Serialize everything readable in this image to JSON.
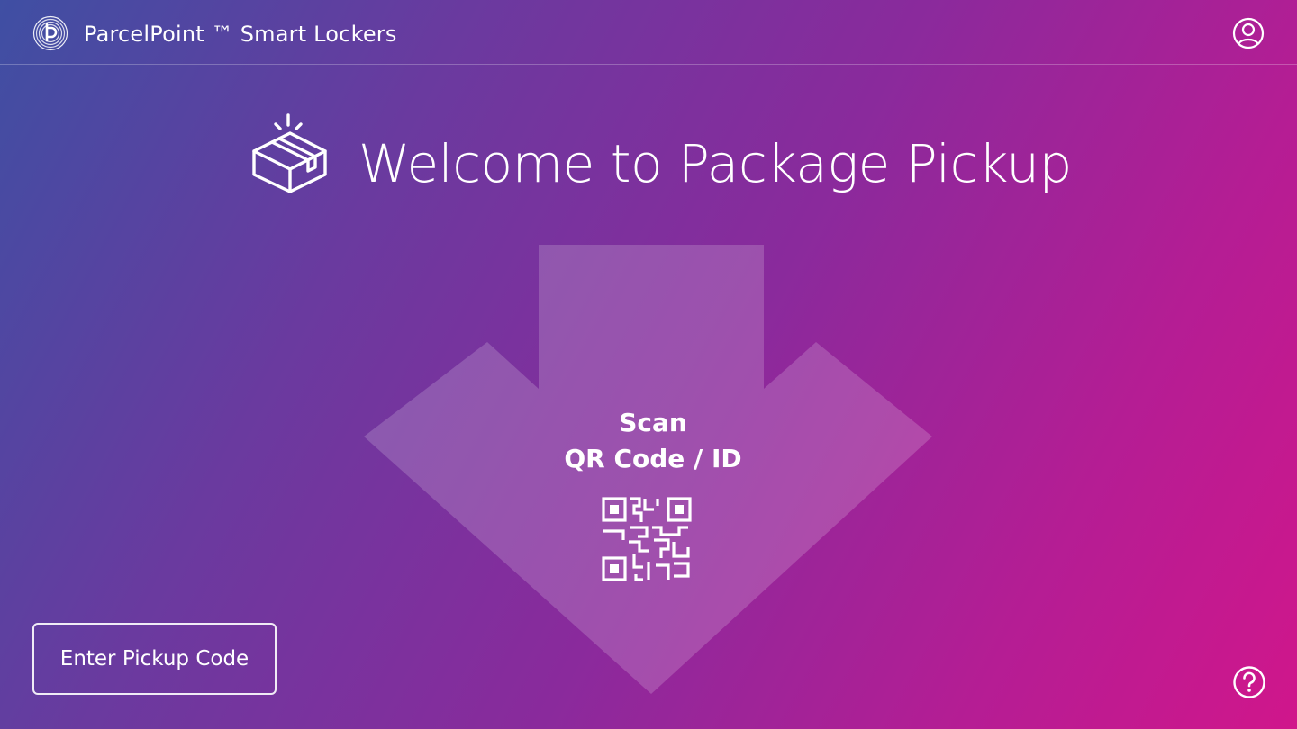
{
  "header": {
    "app_title": "ParcelPoint ™ Smart Lockers",
    "logo_icon": "parcelpoint-logo-icon",
    "account_icon": "user-account-icon"
  },
  "welcome": {
    "title": "Welcome to Package Pickup",
    "icon": "open-box-icon"
  },
  "scan": {
    "line1": "Scan",
    "line2": "QR Code / ID",
    "icon": "qr-code-icon"
  },
  "actions": {
    "enter_pickup_code": "Enter Pickup Code",
    "help_icon": "help-icon"
  },
  "colors": {
    "gradient_start": "#3f4fa3",
    "gradient_mid": "#8a2a9c",
    "gradient_end": "#d0168b",
    "text": "#ffffff"
  }
}
